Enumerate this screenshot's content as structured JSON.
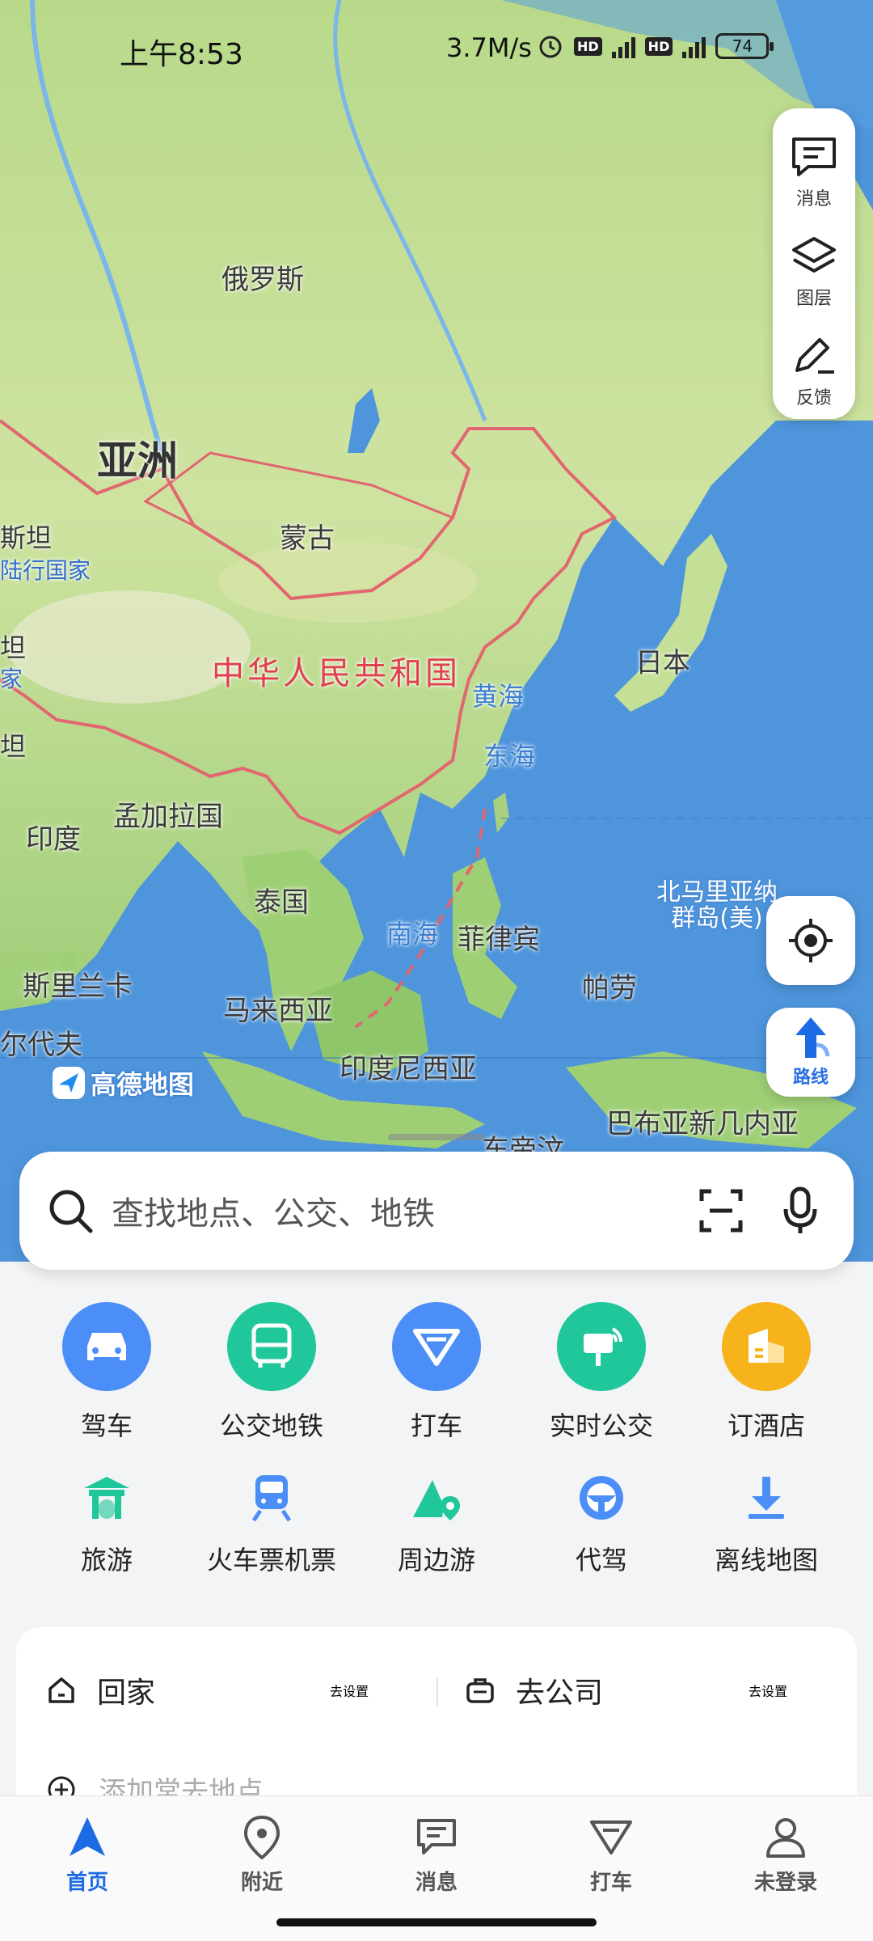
{
  "status_bar": {
    "time": "上午8:53",
    "network_speed": "3.7M/s",
    "battery": "74"
  },
  "map": {
    "labels": {
      "russia": "俄罗斯",
      "asia": "亚洲",
      "mongolia": "蒙古",
      "kazakhstan_partial": "斯坦",
      "landlocked_partial": "陆行国家",
      "china": "中华人民共和国",
      "yellow_sea": "黄海",
      "east_sea": "东海",
      "japan": "日本",
      "bangladesh": "孟加拉国",
      "india": "印度",
      "thailand": "泰国",
      "south_sea": "南海",
      "philippines": "菲律宾",
      "n_mariana": "北马里亚纳\n群岛(美)",
      "palau": "帕劳",
      "sri_lanka": "斯里兰卡",
      "malaysia": "马来西亚",
      "maldives_partial": "尔代夫",
      "indonesia": "印度尼西亚",
      "png": "巴布亚新几内亚",
      "east_timor_partial": "东帝汶",
      "left_partial_1": "坦",
      "left_partial_2": "家",
      "left_partial_3": "坦"
    },
    "logo": "高德地图"
  },
  "tools": {
    "message": "消息",
    "layers": "图层",
    "feedback": "反馈",
    "route": "路线"
  },
  "search": {
    "placeholder": "查找地点、公交、地铁"
  },
  "quick_row1": [
    {
      "label": "驾车",
      "color": "#4c8ef7"
    },
    {
      "label": "公交地铁",
      "color": "#1fc79a"
    },
    {
      "label": "打车",
      "color": "#4c8ef7"
    },
    {
      "label": "实时公交",
      "color": "#1fc79a"
    },
    {
      "label": "订酒店",
      "color": "#f7b31c"
    }
  ],
  "quick_row2": [
    {
      "label": "旅游"
    },
    {
      "label": "火车票机票"
    },
    {
      "label": "周边游"
    },
    {
      "label": "代驾"
    },
    {
      "label": "离线地图"
    }
  ],
  "favorites": {
    "home": "回家",
    "home_action": "去设置",
    "company": "去公司",
    "company_action": "去设置",
    "add": "添加常去地点"
  },
  "nav": {
    "home": "首页",
    "nearby": "附近",
    "message": "消息",
    "taxi": "打车",
    "login": "未登录"
  }
}
